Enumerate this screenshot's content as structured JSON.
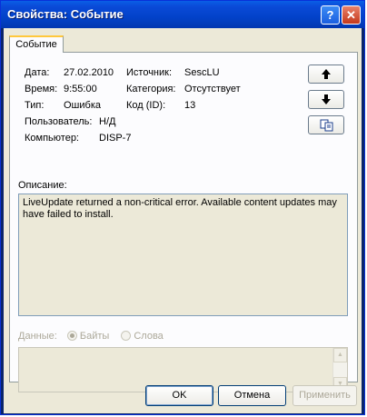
{
  "window": {
    "title": "Свойства: Событие",
    "help_glyph": "?",
    "close_glyph": "✕"
  },
  "tabs": [
    {
      "label": "Событие"
    }
  ],
  "event": {
    "date_label": "Дата:",
    "date": "27.02.2010",
    "time_label": "Время:",
    "time": "9:55:00",
    "type_label": "Тип:",
    "type": "Ошибка",
    "user_label": "Пользователь:",
    "user": "Н/Д",
    "computer_label": "Компьютер:",
    "computer": "DISP-7",
    "source_label": "Источник:",
    "source": "SescLU",
    "category_label": "Категория:",
    "category": "Отсутствует",
    "id_label": "Код (ID):",
    "id": "13"
  },
  "description": {
    "label": "Описание:",
    "text": "LiveUpdate returned a non-critical error.  Available content updates may have failed to install."
  },
  "data_section": {
    "label": "Данные:",
    "options": [
      "Байты",
      "Слова"
    ],
    "selected": "Байты"
  },
  "buttons": {
    "ok": "OK",
    "cancel": "Отмена",
    "apply": "Применить"
  },
  "icons": {
    "up": "arrow-up-icon",
    "down": "arrow-down-icon",
    "copy": "copy-icon"
  }
}
